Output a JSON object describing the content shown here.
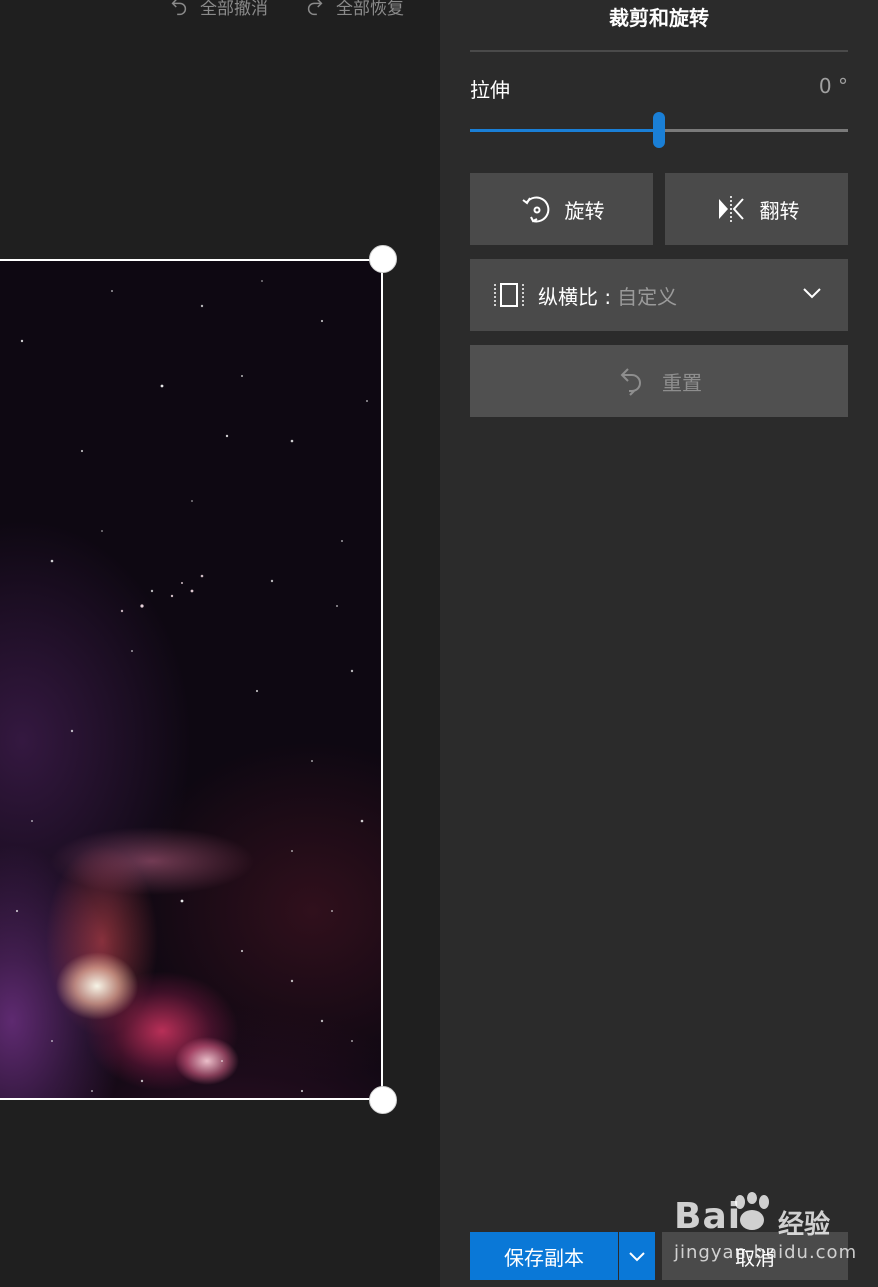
{
  "toolbar": {
    "undo_all_label": "全部撤消",
    "redo_all_label": "全部恢复"
  },
  "panel": {
    "title": "裁剪和旋转",
    "stretch_label": "拉伸",
    "stretch_value": "0 °",
    "stretch_position": 0.5,
    "rotate_label": "旋转",
    "flip_label": "翻转",
    "aspect_label": "纵横比 :",
    "aspect_value": "自定义",
    "reset_label": "重置",
    "save_copy_label": "保存副本",
    "cancel_label": "取消"
  },
  "watermark": {
    "logo_text": "Bai",
    "logo_cn": "经验",
    "url": "jingyan.baidu.com"
  },
  "colors": {
    "accent": "#0a78d7",
    "panel_bg": "#2b2b2b",
    "canvas_bg": "#1f1f1f",
    "button_bg": "#4a4a4a"
  },
  "icons": {
    "undo_all": "undo-icon",
    "redo_all": "redo-icon",
    "rotate": "rotate-icon",
    "flip": "flip-icon",
    "aspect": "aspect-ratio-icon",
    "dropdown": "chevron-down-icon",
    "reset": "reset-icon"
  }
}
